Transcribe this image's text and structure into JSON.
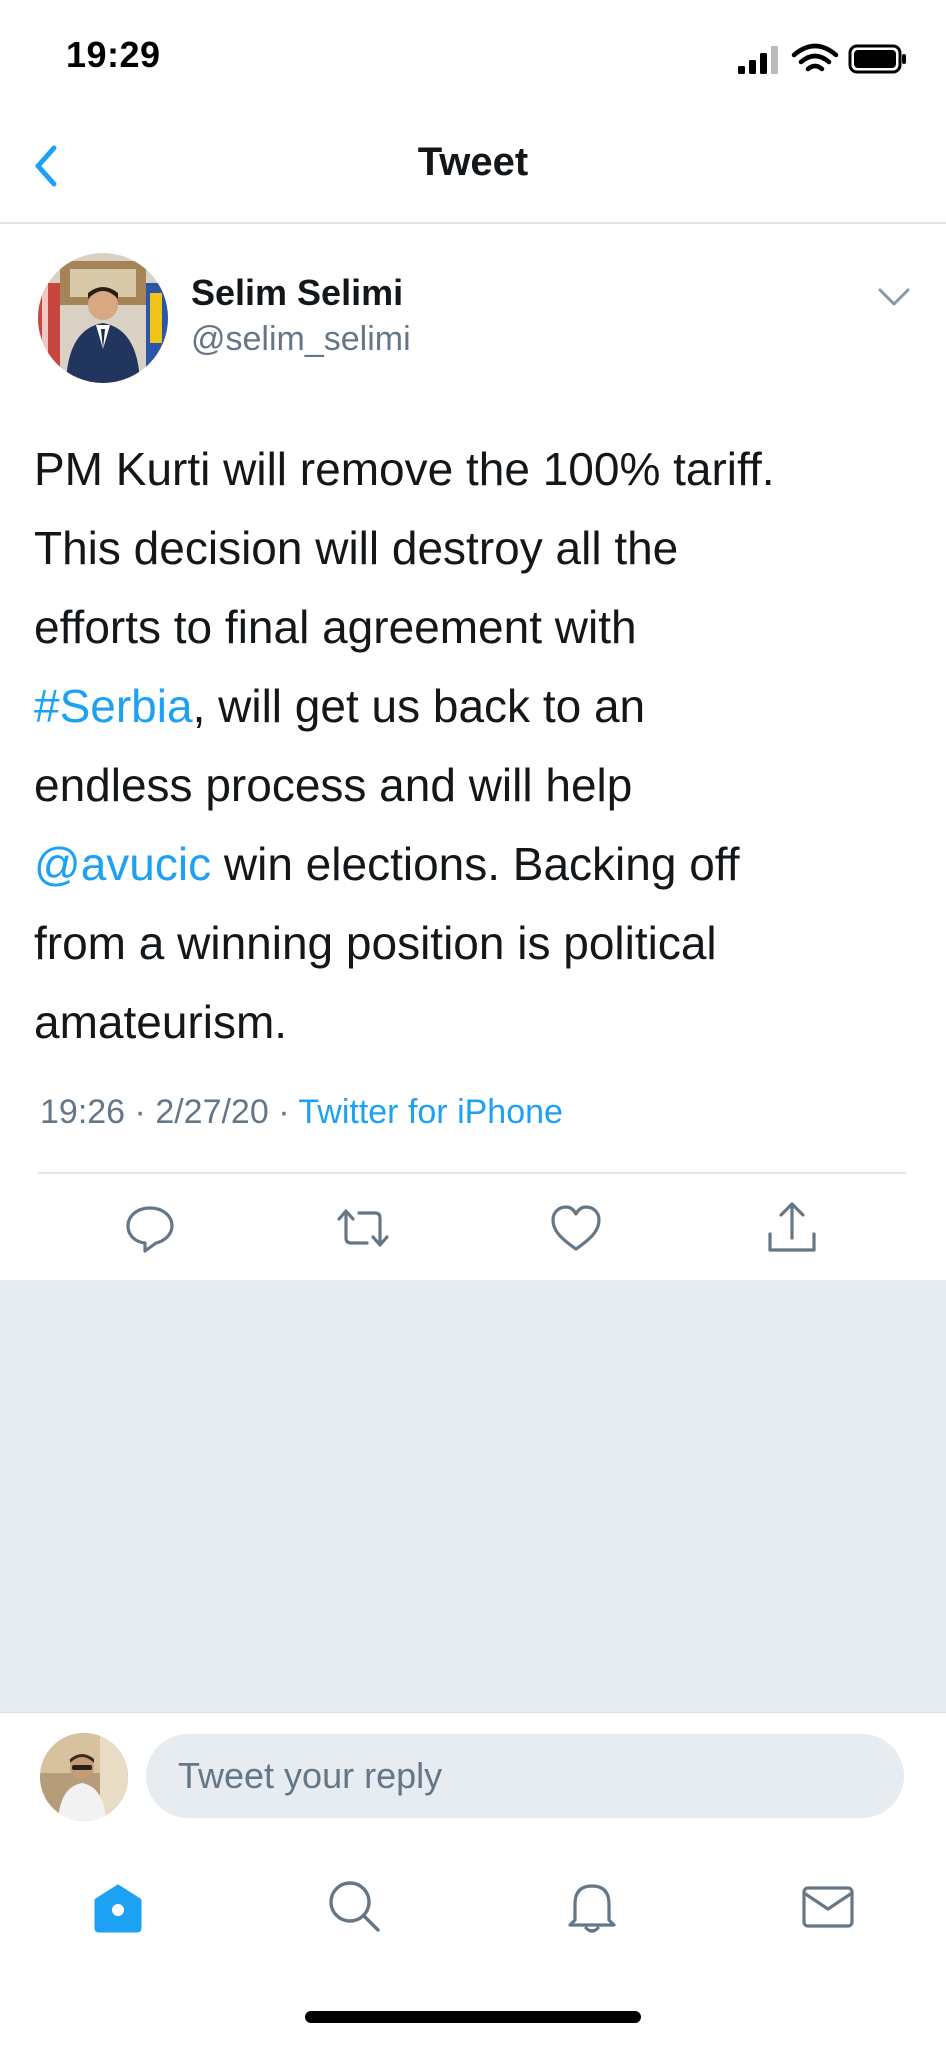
{
  "status_bar": {
    "time": "19:29"
  },
  "header": {
    "title": "Tweet",
    "back_icon": "chevron-left-icon"
  },
  "tweet": {
    "author": {
      "name": "Selim Selimi",
      "handle": "@selim_selimi"
    },
    "text_lines": [
      [
        "PM Kurti will remove the 100% tariff."
      ],
      [
        "This decision will destroy all the"
      ],
      [
        "efforts to final agreement with"
      ],
      [
        "#Serbia",
        ", will get us back to an"
      ],
      [
        "endless process and will help"
      ],
      [
        "@avucic",
        " win elections. Backing off"
      ],
      [
        "from a winning position is political"
      ],
      [
        "amateurism."
      ]
    ],
    "hashtag": "#Serbia",
    "mention": "@avucic",
    "time": "19:26",
    "date": "2/27/20",
    "separator": " · ",
    "source": "Twitter for iPhone"
  },
  "actions": {
    "reply_icon": "reply-icon",
    "retweet_icon": "retweet-icon",
    "like_icon": "heart-icon",
    "share_icon": "share-icon"
  },
  "reply_bar": {
    "placeholder": "Tweet your reply"
  },
  "tab_bar": {
    "tabs": [
      "home-icon",
      "search-icon",
      "bell-icon",
      "mail-icon"
    ]
  },
  "colors": {
    "accent": "#1da1f2",
    "text": "#14171a",
    "secondary": "#657786",
    "background_gray": "#e6ecf0",
    "divider": "#e1e8ed"
  }
}
